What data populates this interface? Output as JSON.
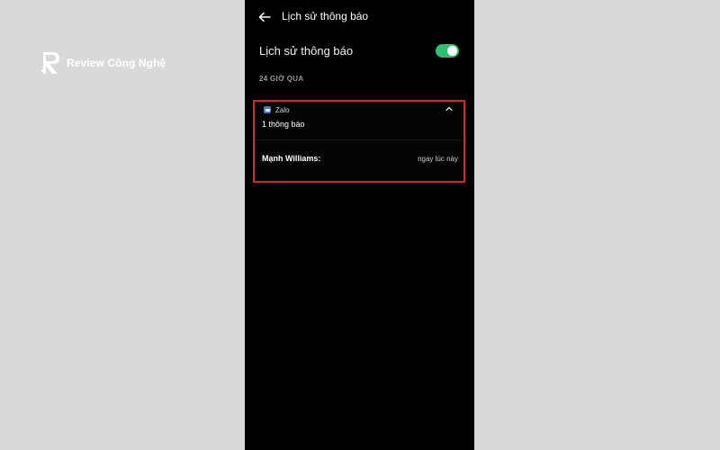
{
  "watermark": {
    "text": "Review Công Nghệ",
    "icon": "r-logo-icon"
  },
  "header": {
    "back_icon": "arrow-left-icon",
    "title": "Lịch sử thông báo"
  },
  "setting": {
    "label": "Lịch sử thông báo",
    "toggle_on": true,
    "toggle_color": "#2fbf71"
  },
  "section": {
    "title": "24 GIỜ QUA"
  },
  "notification_group": {
    "app_icon": "zalo-app-icon",
    "app_name": "Zalo",
    "collapse_icon": "chevron-up-icon",
    "count_text": "1 thông báo",
    "items": [
      {
        "sender": "Mạnh Williams:",
        "time": "ngay lúc này"
      }
    ],
    "highlight_color": "#d8242a"
  }
}
